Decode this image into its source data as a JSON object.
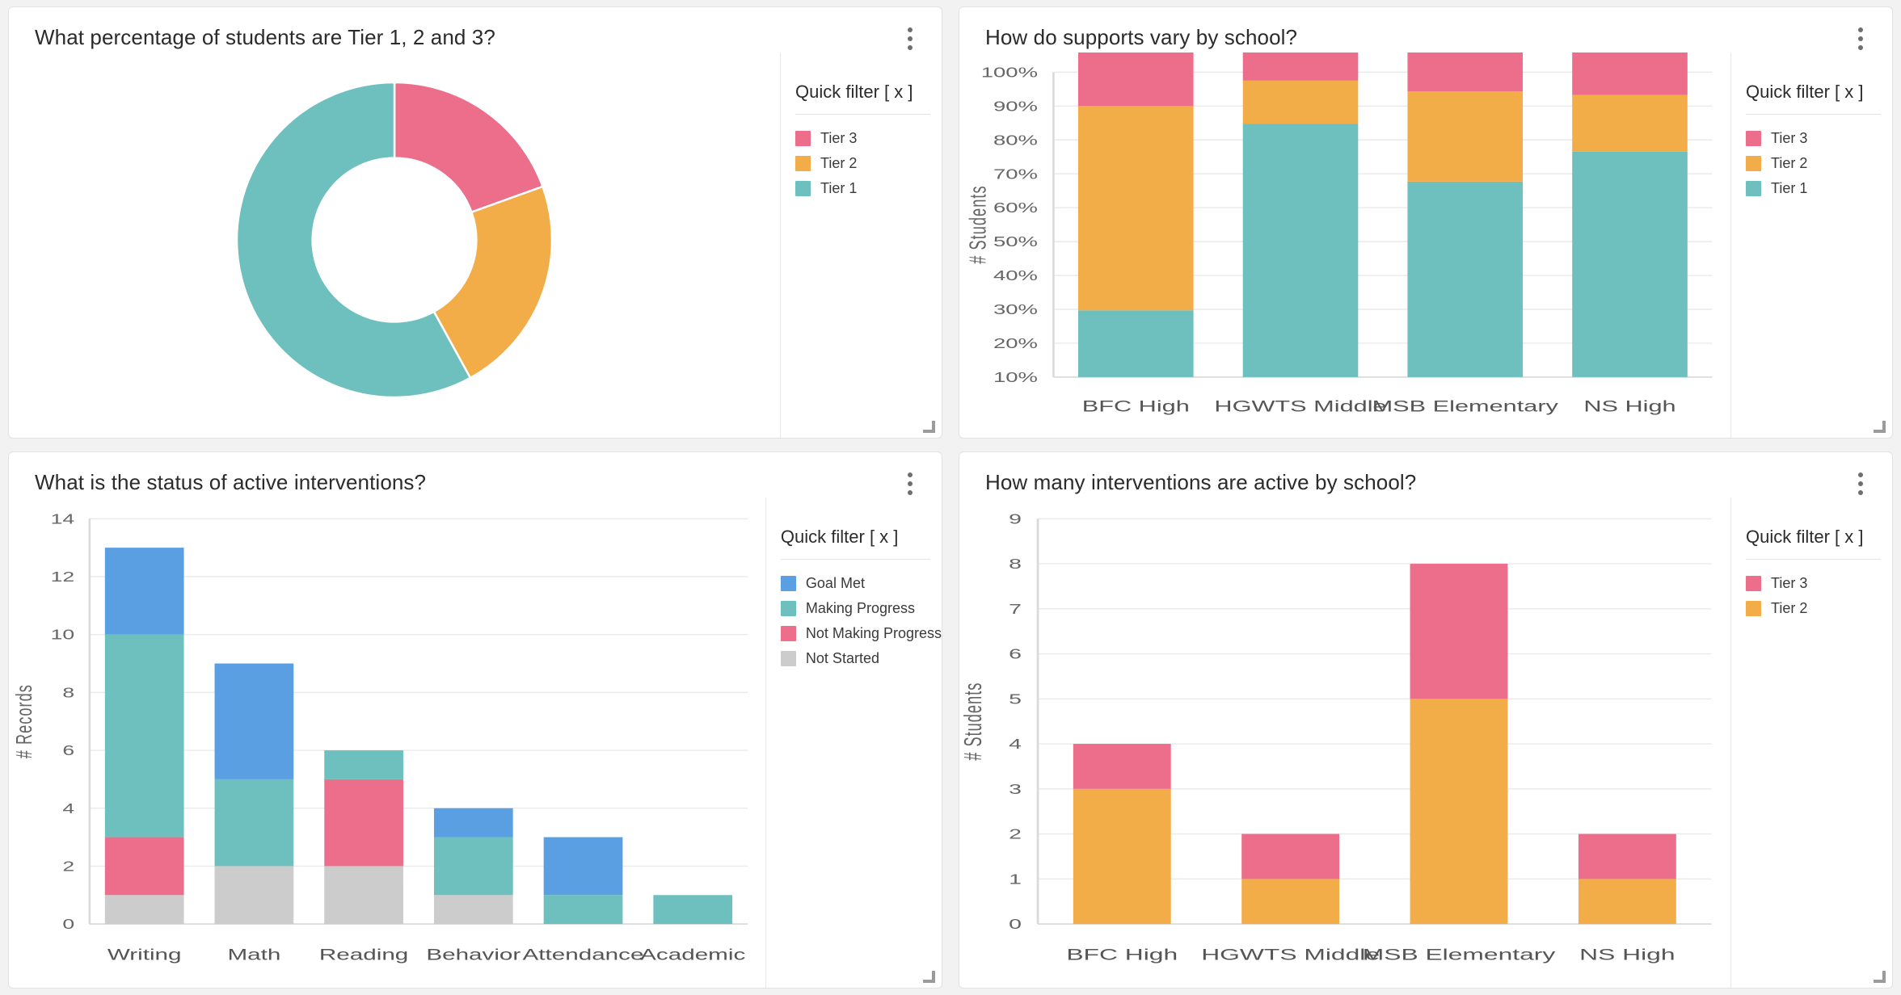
{
  "colors": {
    "tier3_pink": "#ED6E8A",
    "tier2_orange": "#F2AD49",
    "tier1_teal": "#6DC0BE",
    "goal_met_blue": "#5B9FE3",
    "not_started_gray": "#CCCCCC",
    "panel_bg": "#FFFFFF",
    "page_bg": "#F2F2F2",
    "gridline": "#EAEAEA"
  },
  "common": {
    "quick_filter_label": "Quick filter [ x ]",
    "kebab_icon": "kebab-menu-icon",
    "resize_icon": "resize-handle-icon"
  },
  "panels": {
    "tier_donut": {
      "title": "What percentage of students are Tier 1, 2 and 3?",
      "legend": [
        {
          "label": "Tier 3",
          "color": "#ED6E8A"
        },
        {
          "label": "Tier 2",
          "color": "#F2AD49"
        },
        {
          "label": "Tier 1",
          "color": "#6DC0BE"
        }
      ]
    },
    "supports_by_school": {
      "title": "How do supports vary by school?",
      "legend": [
        {
          "label": "Tier 3",
          "color": "#ED6E8A"
        },
        {
          "label": "Tier 2",
          "color": "#F2AD49"
        },
        {
          "label": "Tier 1",
          "color": "#6DC0BE"
        }
      ]
    },
    "intervention_status": {
      "title": "What is the status of active interventions?",
      "legend": [
        {
          "label": "Goal Met",
          "color": "#5B9FE3"
        },
        {
          "label": "Making Progress",
          "color": "#6DC0BE"
        },
        {
          "label": "Not Making Progress",
          "color": "#ED6E8A"
        },
        {
          "label": "Not Started",
          "color": "#CCCCCC"
        }
      ]
    },
    "active_by_school": {
      "title": "How many interventions are active by school?",
      "legend": [
        {
          "label": "Tier 3",
          "color": "#ED6E8A"
        },
        {
          "label": "Tier 2",
          "color": "#F2AD49"
        }
      ]
    }
  },
  "chart_data": [
    {
      "id": "tier_donut",
      "type": "pie",
      "title": "What percentage of students are Tier 1, 2 and 3?",
      "variant": "donut",
      "labels": [
        "Tier 3",
        "Tier 2",
        "Tier 1"
      ],
      "values": [
        19.5,
        22.5,
        58.0
      ],
      "unit": "%",
      "colors": [
        "#ED6E8A",
        "#F2AD49",
        "#6DC0BE"
      ],
      "legend_position": "right",
      "start_angle_deg": 0,
      "inner_radius_ratio": 0.52
    },
    {
      "id": "supports_by_school",
      "type": "bar",
      "stacked": true,
      "normalized": true,
      "title": "How do supports vary by school?",
      "xlabel": "",
      "ylabel": "# Students",
      "categories": [
        "BFC High",
        "HGWTS Middle",
        "MSB Elementary",
        "NS High"
      ],
      "ytick_labels": [
        "10%",
        "20%",
        "30%",
        "40%",
        "50%",
        "60%",
        "70%",
        "80%",
        "90%",
        "100%"
      ],
      "ylim": [
        10,
        100
      ],
      "series": [
        {
          "name": "Tier 1",
          "color": "#6DC0BE",
          "values": [
            19.7,
            74.8,
            57.7,
            66.5
          ]
        },
        {
          "name": "Tier 2",
          "color": "#F2AD49",
          "values": [
            60.3,
            12.7,
            26.6,
            16.8
          ]
        },
        {
          "name": "Tier 3",
          "color": "#ED6E8A",
          "values": [
            20.0,
            12.5,
            15.7,
            16.7
          ]
        }
      ],
      "grid": true,
      "legend_position": "right"
    },
    {
      "id": "intervention_status",
      "type": "bar",
      "stacked": true,
      "title": "What is the status of active interventions?",
      "xlabel": "",
      "ylabel": "# Records",
      "categories": [
        "Writing",
        "Math",
        "Reading",
        "Behavior",
        "Attendance",
        "Academic"
      ],
      "ytick_labels": [
        "0",
        "2",
        "4",
        "6",
        "8",
        "10",
        "12",
        "14"
      ],
      "ylim": [
        0,
        14
      ],
      "series": [
        {
          "name": "Not Started",
          "color": "#CCCCCC",
          "values": [
            1,
            2,
            2,
            1,
            0,
            0
          ]
        },
        {
          "name": "Not Making Progress",
          "color": "#ED6E8A",
          "values": [
            2,
            0,
            3,
            0,
            0,
            0
          ]
        },
        {
          "name": "Making Progress",
          "color": "#6DC0BE",
          "values": [
            7,
            3,
            1,
            2,
            1,
            1
          ]
        },
        {
          "name": "Goal Met",
          "color": "#5B9FE3",
          "values": [
            3,
            4,
            0,
            1,
            2,
            0
          ]
        }
      ],
      "totals": [
        13,
        9,
        6,
        4,
        3,
        1
      ],
      "grid": true,
      "legend_position": "right"
    },
    {
      "id": "active_by_school",
      "type": "bar",
      "stacked": true,
      "title": "How many interventions are active by school?",
      "xlabel": "",
      "ylabel": "# Students",
      "categories": [
        "BFC High",
        "HGWTS Middle",
        "MSB Elementary",
        "NS High"
      ],
      "ytick_labels": [
        "0",
        "1",
        "2",
        "3",
        "4",
        "5",
        "6",
        "7",
        "8",
        "9"
      ],
      "ylim": [
        0,
        9
      ],
      "series": [
        {
          "name": "Tier 2",
          "color": "#F2AD49",
          "values": [
            3,
            1,
            5,
            1
          ]
        },
        {
          "name": "Tier 3",
          "color": "#ED6E8A",
          "values": [
            1,
            1,
            3,
            1
          ]
        }
      ],
      "totals": [
        4,
        2,
        8,
        2
      ],
      "grid": true,
      "legend_position": "right"
    }
  ]
}
